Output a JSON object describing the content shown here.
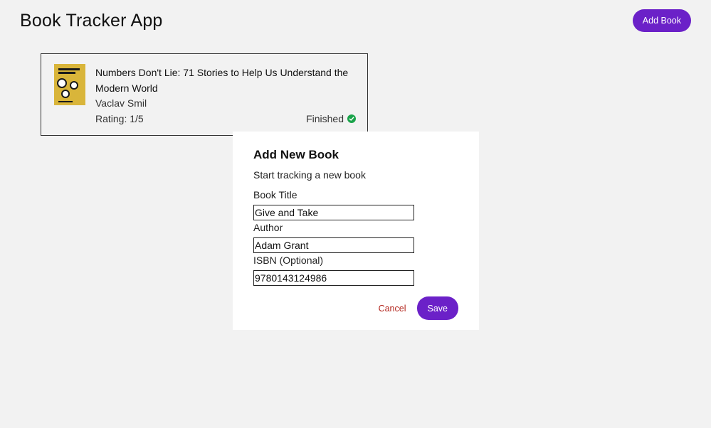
{
  "app": {
    "title": "Book Tracker App",
    "add_book_label": "Add Book"
  },
  "books": [
    {
      "title": "Numbers Don't Lie: 71 Stories to Help Us Understand the Modern World",
      "author": "Vaclav Smil",
      "rating": "Rating: 1/5",
      "status": "Finished",
      "status_color": "#1aa34a",
      "cover_color": "#d9b53a"
    }
  ],
  "modal": {
    "title": "Add New Book",
    "subtitle": "Start tracking a new book",
    "fields": {
      "title_label": "Book Title",
      "title_value": "Give and Take",
      "author_label": "Author",
      "author_value": "Adam Grant",
      "isbn_label": "ISBN (Optional)",
      "isbn_value": "9780143124986"
    },
    "cancel_label": "Cancel",
    "save_label": "Save"
  },
  "colors": {
    "accent": "#6b21c8",
    "danger": "#b3261e",
    "background": "#f2f2f2"
  }
}
